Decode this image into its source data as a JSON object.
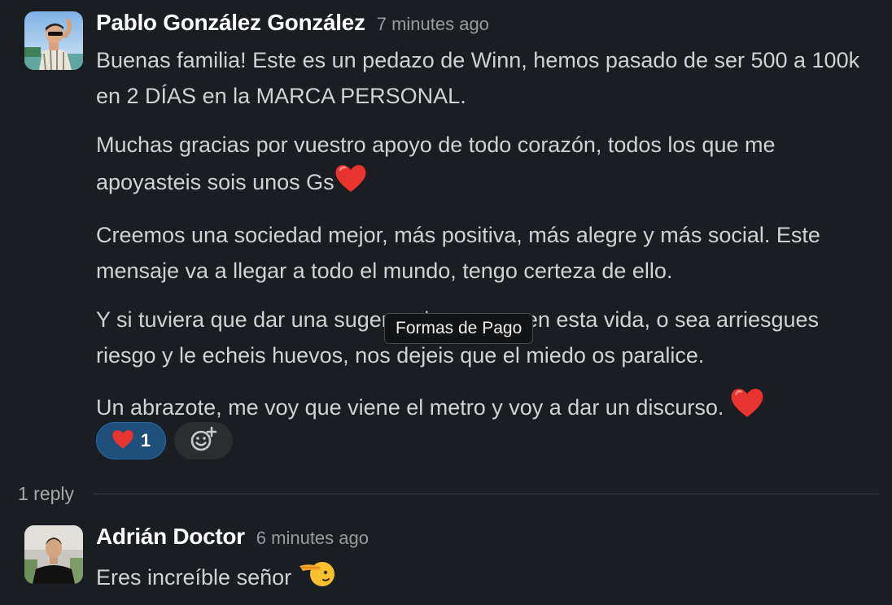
{
  "message": {
    "author": "Pablo González González",
    "timestamp": "7 minutes ago",
    "paragraphs": [
      "Buenas familia! Este es un pedazo de Winn, hemos pasado de ser 500 a 100k en 2 DÍAS en la MARCA PERSONAL.",
      "Muchas gracias por vuestro apoyo de todo corazón, todos los que me apoyasteis sois unos Gs",
      "Creemos una sociedad mejor, más positiva, más alegre y más social. Este mensaje va a llegar a todo el mundo, tengo certeza de ello.",
      "Y si tuviera que dar una sugerencia, es que en esta vida, o sea arriesgues riesgo y le echeis huevos, nos dejeis que el miedo os paralice.",
      "Un abrazote, me voy que viene el metro y voy a dar un discurso."
    ],
    "reactions": [
      {
        "emoji": "heart",
        "count": "1"
      }
    ],
    "add_reaction_icon": "add-emoji-icon"
  },
  "thread": {
    "reply_count": "1 reply"
  },
  "reply": {
    "author": "Adrián Doctor",
    "timestamp": "6 minutes ago",
    "text": "Eres increíble señor",
    "emoji": "saluting-face"
  },
  "tooltip": {
    "text": "Formas de Pago"
  },
  "colors": {
    "background": "#1a1d21",
    "reaction_active": "#1d4f7a",
    "heart": "#e8332e"
  }
}
